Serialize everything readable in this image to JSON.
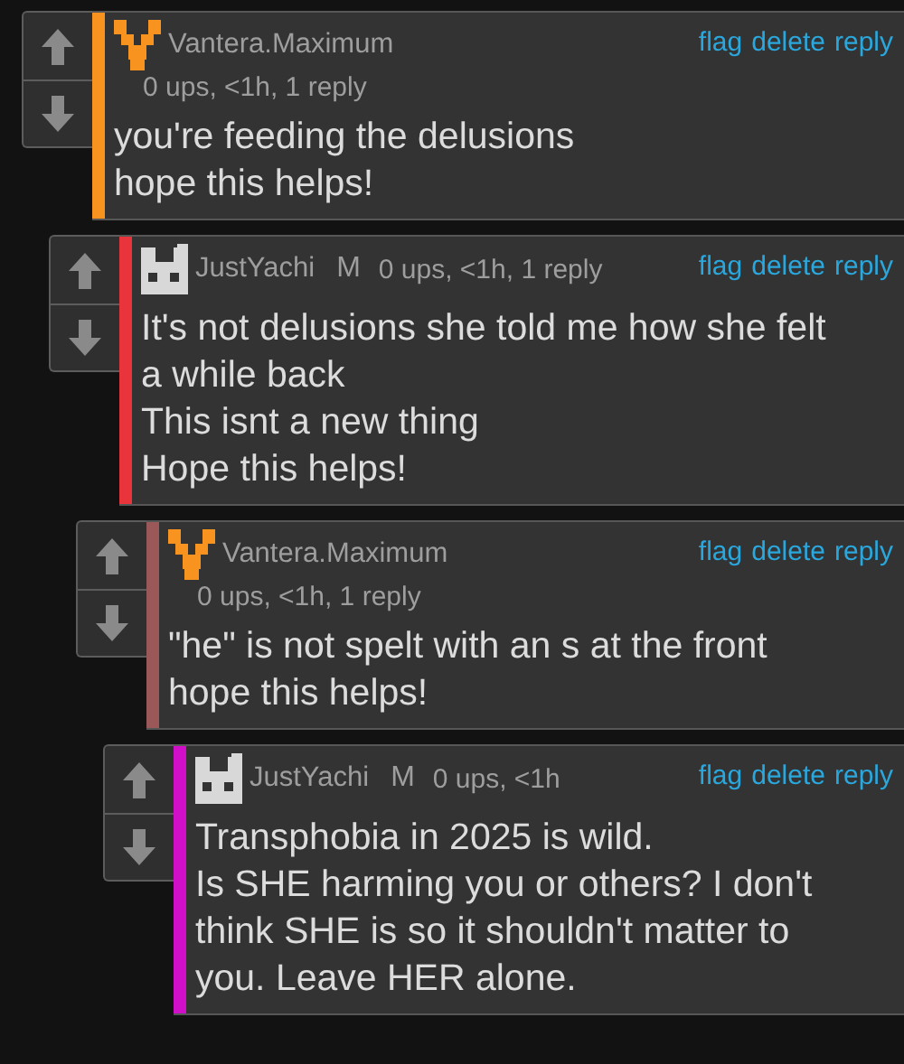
{
  "comments": [
    {
      "author": "Vantera.Maximum",
      "avatar": {
        "kind": "chevron"
      },
      "kind": "stacked",
      "meta": "0 ups, <1h, 1 reply",
      "actions": [
        "flag",
        "delete",
        "reply"
      ],
      "color": "#f7931e",
      "text": [
        "you're feeding the delusions",
        "hope this helps!"
      ],
      "children": [
        {
          "author": "JustYachi",
          "badge": "M",
          "avatar": {
            "kind": "face"
          },
          "kind": "inline",
          "meta": "0 ups, <1h, 1 reply",
          "actions": [
            "flag",
            "delete",
            "reply"
          ],
          "color": "#e8343a",
          "text": [
            "It's not delusions she told me how she felt",
            "a while back",
            "This isnt a new thing",
            "Hope this helps!"
          ],
          "children": [
            {
              "author": "Vantera.Maximum",
              "avatar": {
                "kind": "chevron"
              },
              "kind": "stacked",
              "meta": "0 ups, <1h, 1 reply",
              "actions": [
                "flag",
                "delete",
                "reply"
              ],
              "color": "#9a5858",
              "text": [
                "\"he\" is not spelt with an s at the front",
                "hope this helps!"
              ],
              "children": [
                {
                  "author": "JustYachi",
                  "badge": "M",
                  "avatar": {
                    "kind": "face"
                  },
                  "kind": "inline",
                  "meta": "0 ups, <1h",
                  "actions": [
                    "flag",
                    "delete",
                    "reply"
                  ],
                  "color": "#d10fc8",
                  "text": [
                    "Transphobia in 2025 is wild.",
                    "Is SHE harming you or others? I don't",
                    "think SHE is so it shouldn't matter to",
                    "you. Leave HER alone."
                  ]
                }
              ]
            }
          ]
        }
      ]
    }
  ]
}
